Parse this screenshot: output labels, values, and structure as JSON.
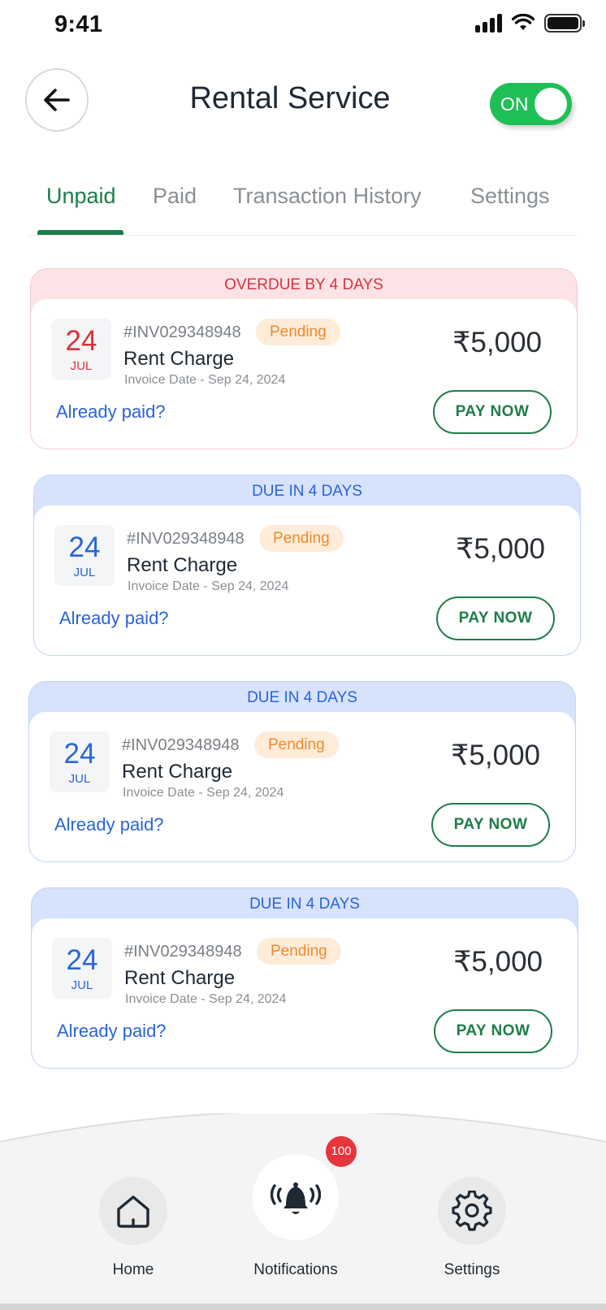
{
  "status_bar": {
    "time": "9:41"
  },
  "header": {
    "title": "Rental Service",
    "toggle_label": "ON"
  },
  "tabs": [
    {
      "label": "Unpaid",
      "active": true
    },
    {
      "label": "Paid",
      "active": false
    },
    {
      "label": "Transaction History",
      "active": false
    },
    {
      "label": "Settings",
      "active": false
    }
  ],
  "invoices": [
    {
      "banner": "OVERDUE BY 4 DAYS",
      "day": "24",
      "month": "JUL",
      "invoice_id": "#INV029348948",
      "status": "Pending",
      "charge": "Rent Charge",
      "invoice_date": "Invoice Date - Sep 24, 2024",
      "amount": "₹5,000",
      "already_paid": "Already paid?",
      "pay_label": "PAY NOW"
    },
    {
      "banner": "DUE IN 4 DAYS",
      "day": "24",
      "month": "JUL",
      "invoice_id": "#INV029348948",
      "status": "Pending",
      "charge": "Rent Charge",
      "invoice_date": "Invoice Date - Sep 24, 2024",
      "amount": "₹5,000",
      "already_paid": "Already paid?",
      "pay_label": "PAY NOW"
    },
    {
      "banner": "DUE IN 4 DAYS",
      "day": "24",
      "month": "JUL",
      "invoice_id": "#INV029348948",
      "status": "Pending",
      "charge": "Rent Charge",
      "invoice_date": "Invoice Date - Sep 24, 2024",
      "amount": "₹5,000",
      "already_paid": "Already paid?",
      "pay_label": "PAY NOW"
    },
    {
      "banner": "DUE IN 4 DAYS",
      "day": "24",
      "month": "JUL",
      "invoice_id": "#INV029348948",
      "status": "Pending",
      "charge": "Rent Charge",
      "invoice_date": "Invoice Date - Sep 24, 2024",
      "amount": "₹5,000",
      "already_paid": "Already paid?",
      "pay_label": "PAY NOW"
    }
  ],
  "bottom_nav": {
    "home_label": "Home",
    "notifications_label": "Notifications",
    "notifications_count": "100",
    "settings_label": "Settings"
  },
  "colors": {
    "accent_green": "#1e7d4a",
    "toggle_green": "#1fbf57",
    "overdue_red": "#d8333b",
    "due_blue": "#2a64d8",
    "pending_orange": "#f08a2c"
  },
  "icons": [
    "back-arrow-icon",
    "signal-icon",
    "wifi-icon",
    "battery-icon",
    "home-icon",
    "bell-icon",
    "gear-icon"
  ]
}
